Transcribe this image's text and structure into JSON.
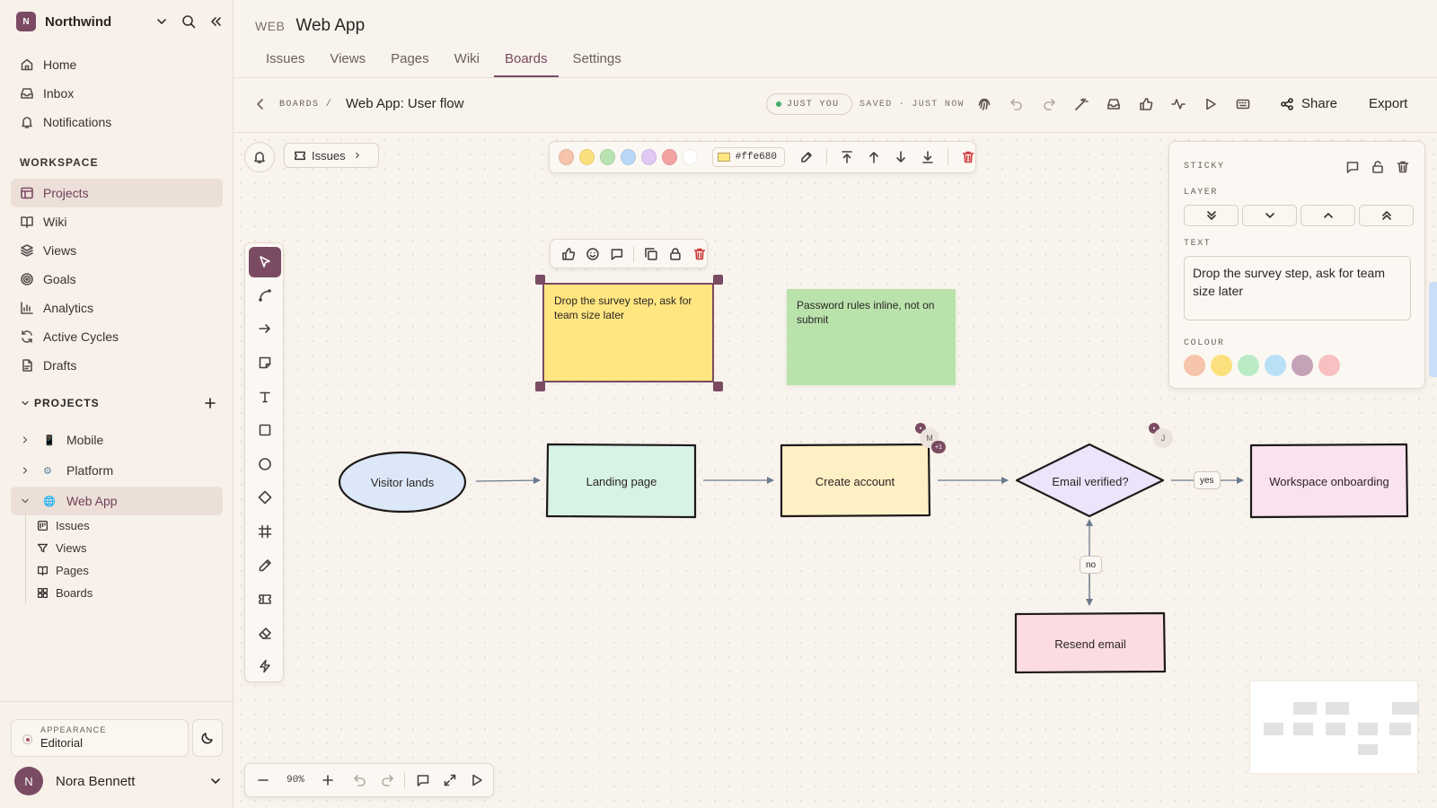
{
  "workspace": {
    "initial": "N",
    "name": "Northwind"
  },
  "nav": {
    "home": "Home",
    "inbox": "Inbox",
    "notifications": "Notifications",
    "workspace_label": "WORKSPACE",
    "projects": "Projects",
    "wiki": "Wiki",
    "views": "Views",
    "goals": "Goals",
    "analytics": "Analytics",
    "active_cycles": "Active Cycles",
    "drafts": "Drafts"
  },
  "projects": {
    "label": "PROJECTS",
    "items": [
      {
        "name": "Mobile",
        "emoji": "📱"
      },
      {
        "name": "Platform",
        "emoji": "⚙"
      },
      {
        "name": "Web App",
        "emoji": "🌐"
      }
    ],
    "sub_items": [
      "Issues",
      "Views",
      "Pages",
      "Boards"
    ]
  },
  "appearance": {
    "label": "APPEARANCE",
    "value": "Editorial"
  },
  "user": {
    "initial": "N",
    "name": "Nora Bennett"
  },
  "header": {
    "kicker": "WEB",
    "title": "Web App",
    "tabs": [
      "Issues",
      "Views",
      "Pages",
      "Wiki",
      "Boards",
      "Settings"
    ],
    "active_tab": "Boards"
  },
  "toolbar": {
    "crumb": "BOARDS /",
    "board_title": "Web App: User flow",
    "presence": "JUST YOU",
    "saved": "SAVED · JUST NOW",
    "share": "Share",
    "export": "Export"
  },
  "canvas": {
    "issues_chip": "Issues",
    "format": {
      "swatches": [
        "#f6c3ab",
        "#fbe07d",
        "#b9e3b1",
        "#b9d7f7",
        "#e0c9f5",
        "#f4a3a3",
        "#ffffff"
      ],
      "hex": "#ffe680"
    },
    "stickies": [
      {
        "text": "Drop the survey step, ask for team size later",
        "color": "#ffe680",
        "selected": true
      },
      {
        "text": "Password rules inline, not on submit",
        "color": "#b9e3ab",
        "selected": false
      }
    ],
    "nodes": {
      "visitor": "Visitor lands",
      "landing": "Landing page",
      "create": "Create account",
      "verified": "Email verified?",
      "onboarding": "Workspace onboarding",
      "resend": "Resend email"
    },
    "edge_labels": {
      "yes": "yes",
      "no": "no"
    },
    "cursors": [
      {
        "initial": "M",
        "extra": "+1"
      },
      {
        "initial": "J"
      }
    ],
    "zoom": "90%"
  },
  "panel": {
    "kicker": "STICKY",
    "layer_label": "LAYER",
    "text_label": "TEXT",
    "text_value": "Drop the survey step, ask for team size later",
    "colour_label": "COLOUR",
    "colours": [
      "#f6c3ab",
      "#fbe07d",
      "#b9ebc5",
      "#b9e0f7",
      "#c4a2b8",
      "#f8c0c0"
    ]
  },
  "colors": {
    "accent": "#7a4b63",
    "background": "#f8f3ec"
  }
}
